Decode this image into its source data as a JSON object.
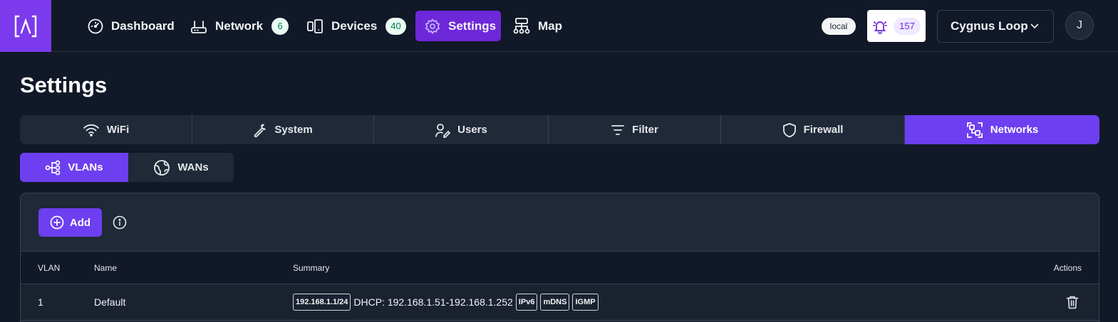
{
  "nav": {
    "items": [
      {
        "label": "Dashboard",
        "icon": "gauge-icon"
      },
      {
        "label": "Network",
        "icon": "router-icon",
        "badge": "6"
      },
      {
        "label": "Devices",
        "icon": "devices-icon",
        "badge": "40"
      },
      {
        "label": "Settings",
        "icon": "gear-icon",
        "active": true
      },
      {
        "label": "Map",
        "icon": "topology-icon"
      }
    ],
    "local_badge": "local",
    "alerts_count": "157",
    "site_name": "Cygnus Loop",
    "avatar_initial": "J"
  },
  "page": {
    "title": "Settings"
  },
  "tabs": [
    {
      "label": "WiFi",
      "icon": "wifi-icon"
    },
    {
      "label": "System",
      "icon": "wrench-icon"
    },
    {
      "label": "Users",
      "icon": "users-icon"
    },
    {
      "label": "Filter",
      "icon": "filter-icon"
    },
    {
      "label": "Firewall",
      "icon": "shield-icon"
    },
    {
      "label": "Networks",
      "icon": "networks-icon",
      "active": true
    }
  ],
  "subtabs": [
    {
      "label": "VLANs",
      "icon": "share-nodes-icon",
      "active": true
    },
    {
      "label": "WANs",
      "icon": "globe-icon"
    }
  ],
  "card": {
    "add_label": "Add",
    "columns": {
      "vlan": "VLAN",
      "name": "Name",
      "summary": "Summary",
      "actions": "Actions"
    },
    "rows": [
      {
        "vlan": "1",
        "name": "Default",
        "cidr": "192.168.1.1/24",
        "dhcp": "DHCP: 192.168.1.51-192.168.1.252",
        "tags": [
          "IPv6",
          "mDNS",
          "IGMP"
        ]
      }
    ]
  },
  "colors": {
    "accent": "#6d3ff0",
    "background": "#111827",
    "surface": "#1f2937"
  }
}
